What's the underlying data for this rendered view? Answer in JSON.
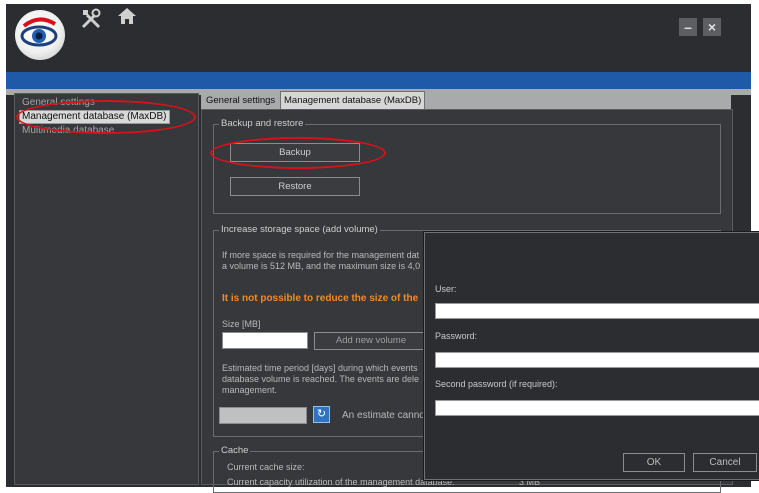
{
  "window": {
    "minimize_label": "–",
    "close_label": "×",
    "icons": [
      "eye-logo",
      "tools-icon",
      "home-icon"
    ]
  },
  "sidebar": {
    "items": [
      {
        "label": "General settings",
        "selected": false
      },
      {
        "label": "Management database (MaxDB)",
        "selected": true
      },
      {
        "label": "Multimedia database",
        "selected": false
      }
    ]
  },
  "tabs": [
    {
      "label": "General settings",
      "active": false
    },
    {
      "label": "Management database (MaxDB)",
      "active": true
    }
  ],
  "backup_group": {
    "title": "Backup and restore",
    "backup_label": "Backup",
    "restore_label": "Restore"
  },
  "storage_group": {
    "title": "Increase storage space (add volume)",
    "desc_line1": "If more space is required for the management dat",
    "desc_line2": "a volume is 512 MB, and the maximum size is 4,0",
    "warning": "It is not possible to reduce the size of the",
    "size_label": "Size [MB]",
    "size_value": "",
    "add_volume_label": "Add new volume",
    "estimate_line1": "Estimated time period [days] during which events",
    "estimate_line2": "database volume is reached. The events are dele",
    "estimate_line3": "management.",
    "estimate_value": "",
    "estimate_note": "An estimate cannot"
  },
  "cache_group": {
    "title": "Cache",
    "current_size_label": "Current cache size:",
    "utilization_label": "Current capacity utilization of the management database:",
    "utilization_value": "3 MB"
  },
  "dialog": {
    "user_label": "User:",
    "user_value": "",
    "password_label": "Password:",
    "password_value": "",
    "second_password_label": "Second password (if required):",
    "second_password_value": "",
    "ok_label": "OK",
    "cancel_label": "Cancel"
  },
  "colors": {
    "accent_blue": "#1e5aa8",
    "highlight_ring": "#d8121b",
    "warning_orange": "#ef8b2c"
  }
}
